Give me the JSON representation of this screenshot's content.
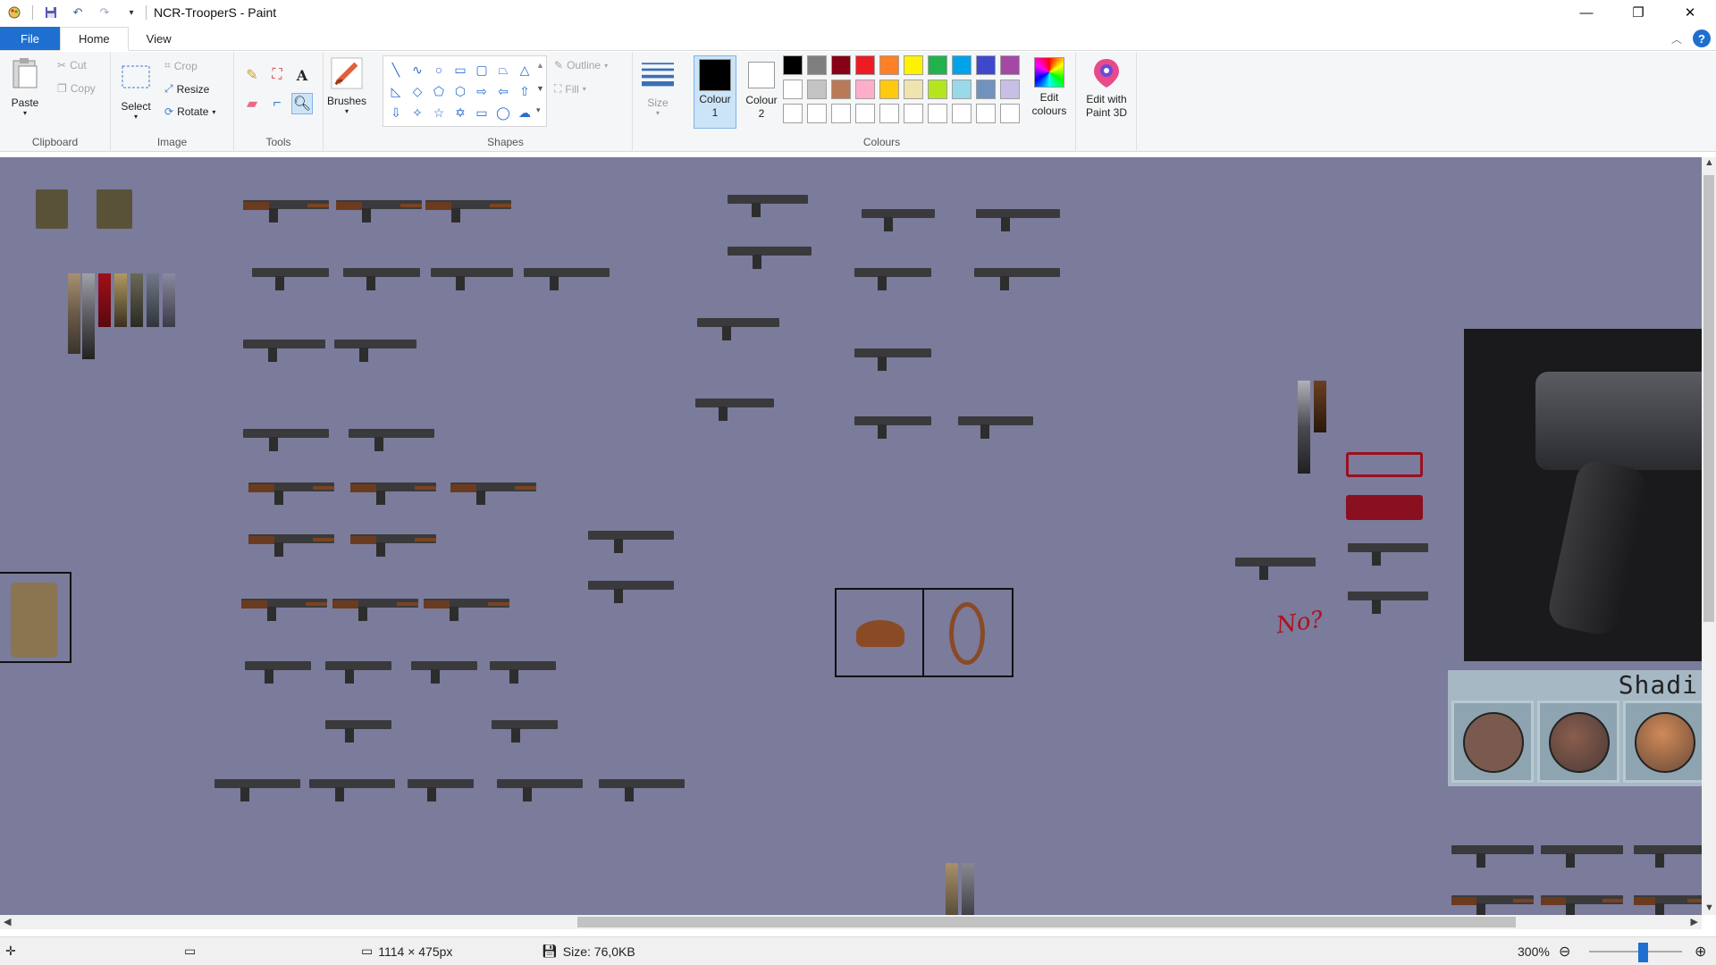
{
  "window": {
    "title": "NCR-TrooperS - Paint",
    "minimize": "—",
    "maximize": "❐",
    "close": "✕"
  },
  "tabs": [
    {
      "label": "File"
    },
    {
      "label": "Home"
    },
    {
      "label": "View"
    }
  ],
  "ribbon": {
    "clipboard": {
      "label": "Clipboard",
      "paste": "Paste",
      "cut": "Cut",
      "copy": "Copy"
    },
    "image": {
      "label": "Image",
      "select": "Select",
      "crop": "Crop",
      "resize": "Resize",
      "rotate": "Rotate"
    },
    "tools": {
      "label": "Tools",
      "brushes": "Brushes"
    },
    "shapes": {
      "label": "Shapes",
      "outline": "Outline",
      "fill": "Fill"
    },
    "size": {
      "label": "Size"
    },
    "colours": {
      "label": "Colours",
      "colour1": "Colour\n1",
      "colour2": "Colour\n2",
      "colour1_line1": "Colour",
      "colour1_line2": "1",
      "colour2_line1": "Colour",
      "colour2_line2": "2",
      "edit_colours_line1": "Edit",
      "edit_colours_line2": "colours",
      "paint3d_line1": "Edit with",
      "paint3d_line2": "Paint 3D",
      "colour1_value": "#000000",
      "colour2_value": "#ffffff",
      "palette_row1": [
        "#000000",
        "#7f7f7f",
        "#880015",
        "#ed1c24",
        "#ff7f27",
        "#fff200",
        "#22b14c",
        "#00a2e8",
        "#3f48cc",
        "#a349a4"
      ],
      "palette_row2": [
        "#ffffff",
        "#c3c3c3",
        "#b97a57",
        "#ffaec9",
        "#ffc90e",
        "#efe4b0",
        "#b5e61d",
        "#99d9ea",
        "#7092be",
        "#c8bfe7"
      ],
      "palette_row3": [
        "#ffffff",
        "#ffffff",
        "#ffffff",
        "#ffffff",
        "#ffffff",
        "#ffffff",
        "#ffffff",
        "#ffffff",
        "#ffffff",
        "#ffffff"
      ]
    }
  },
  "canvas": {
    "background": "#7b7b9b",
    "annotation_text": "No?",
    "shading_label": "Shadi"
  },
  "status": {
    "dimensions": "1114 × 475px",
    "size": "Size: 76,0KB",
    "zoom": "300%",
    "zoom_level": 0.58
  }
}
